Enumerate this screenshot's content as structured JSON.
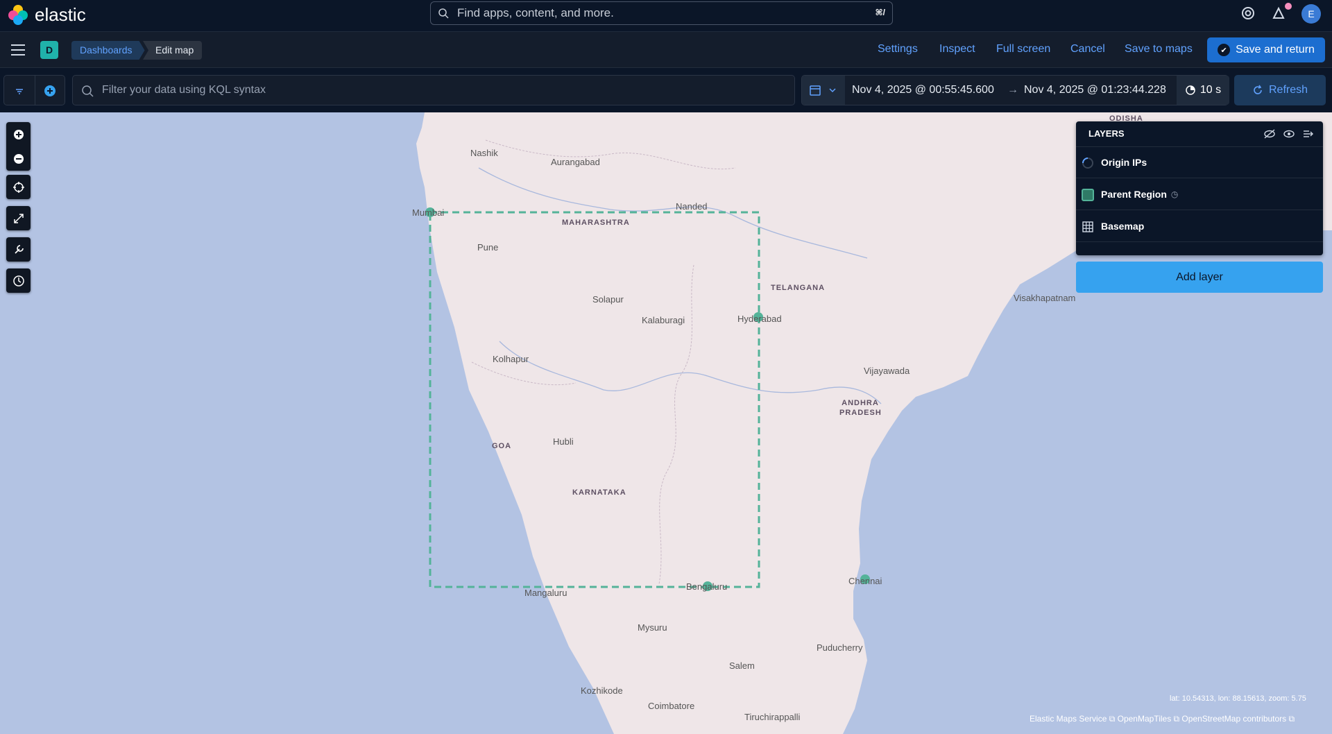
{
  "header": {
    "brand": "elastic",
    "search_placeholder": "Find apps, content, and more.",
    "search_shortcut": "⌘/",
    "avatar_initial": "E"
  },
  "nav": {
    "space_initial": "D",
    "breadcrumbs": [
      "Dashboards",
      "Edit map"
    ],
    "links": [
      "Settings",
      "Inspect",
      "Full screen",
      "Cancel",
      "Save to maps"
    ],
    "primary_action": "Save and return"
  },
  "query": {
    "kql_placeholder": "Filter your data using KQL syntax",
    "start": "Nov 4, 2025 @ 00:55:45.600",
    "end": "Nov 4, 2025 @ 01:23:44.228",
    "auto_refresh": "10 s",
    "refresh_label": "Refresh"
  },
  "map": {
    "cities": [
      {
        "name": "Nashik"
      },
      {
        "name": "Aurangabad"
      },
      {
        "name": "Mumbai"
      },
      {
        "name": "Nanded"
      },
      {
        "name": "Pune"
      },
      {
        "name": "Solapur"
      },
      {
        "name": "Kalaburagi"
      },
      {
        "name": "Hyderabad"
      },
      {
        "name": "Kolhapur"
      },
      {
        "name": "Vijayawada"
      },
      {
        "name": "Visakhapatnam"
      },
      {
        "name": "Hubli"
      },
      {
        "name": "Bengaluru"
      },
      {
        "name": "Mangaluru"
      },
      {
        "name": "Chennai"
      },
      {
        "name": "Mysuru"
      },
      {
        "name": "Puducherry"
      },
      {
        "name": "Salem"
      },
      {
        "name": "Kozhikode"
      },
      {
        "name": "Coimbatore"
      },
      {
        "name": "Tiruchirappalli"
      }
    ],
    "states": [
      {
        "name": "MAHARASHTRA"
      },
      {
        "name": "TELANGANA"
      },
      {
        "name": "ANDHRA PRADESH"
      },
      {
        "name": "GOA"
      },
      {
        "name": "KARNATAKA"
      },
      {
        "name": "ODISHA"
      }
    ],
    "coords_readout": "lat: 10.54313, lon: 88.15613, zoom: 5.75",
    "attribution": "Elastic Maps Service ⧉ OpenMapTiles ⧉ OpenStreetMap contributors ⧉"
  },
  "layers_panel": {
    "title": "LAYERS",
    "layers": [
      {
        "name": "Origin IPs",
        "icon": "loading-spinner-icon"
      },
      {
        "name": "Parent Region",
        "icon": "region-swatch-icon"
      },
      {
        "name": "Basemap",
        "icon": "grid-icon"
      }
    ],
    "add_layer_label": "Add layer"
  },
  "colors": {
    "accent": "#1c6ed0",
    "link": "#61a2ff",
    "water": "#b3c3e3",
    "land": "#efe6e8",
    "region_outline": "#54b399"
  }
}
